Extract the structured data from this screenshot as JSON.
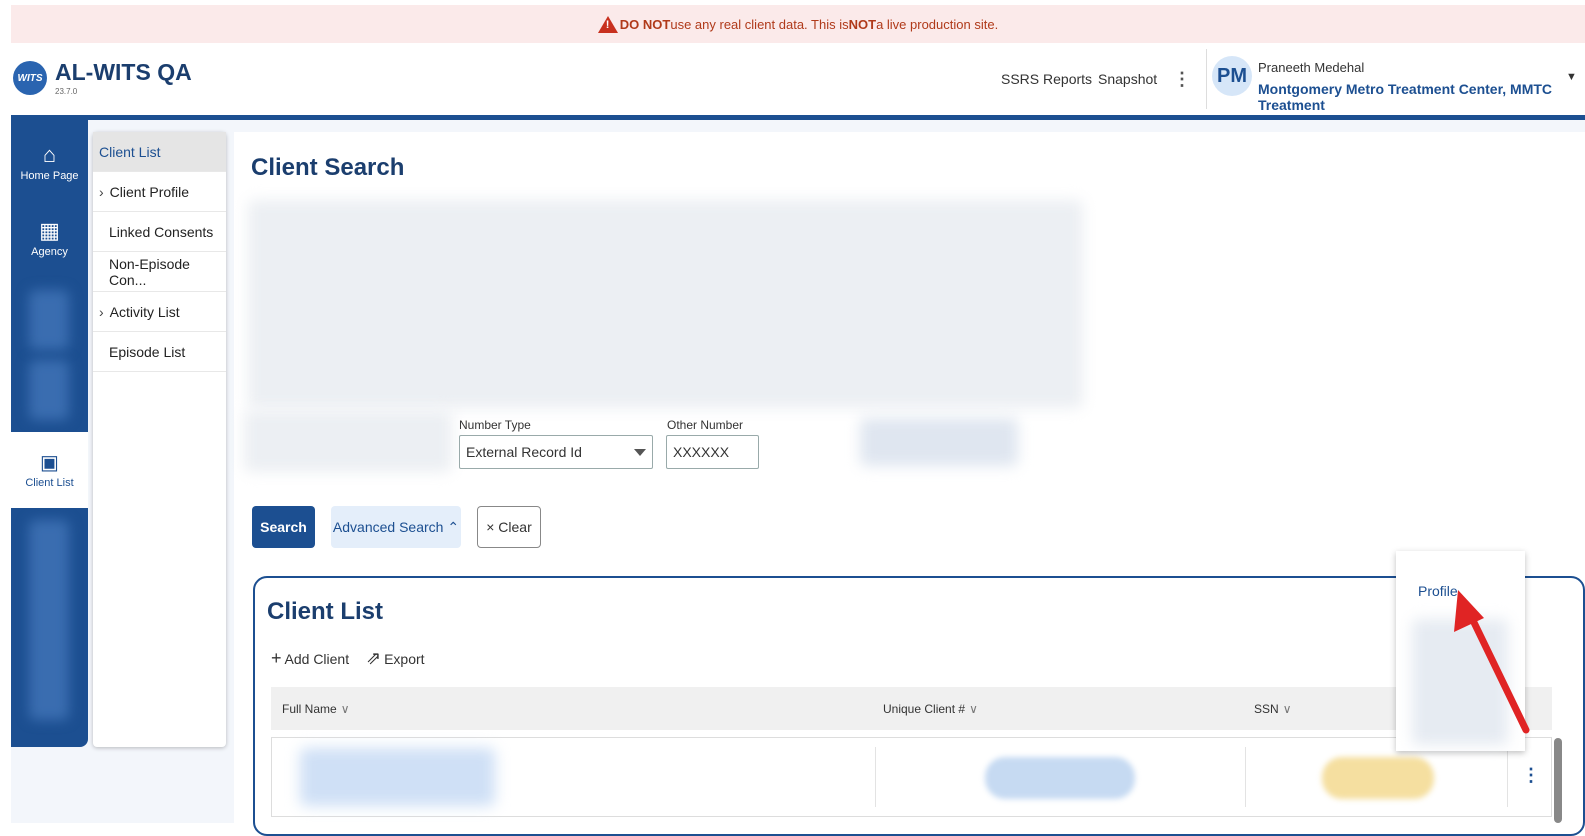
{
  "banner": {
    "part1": "DO NOT",
    "part2": " use any real client data. This is ",
    "part3": "NOT",
    "part4": " a live production site."
  },
  "header": {
    "logo_text": "WITS",
    "app_title": "AL-WITS QA",
    "version": "23.7.0",
    "links": [
      "SSRS Reports",
      "Snapshot"
    ],
    "user_initials": "PM",
    "user_name": "Praneeth Medehal",
    "user_org": "Montgomery Metro Treatment Center, MMTC Treatment"
  },
  "rail": {
    "home_label": "Home Page",
    "agency_label": "Agency",
    "clientlist_label": "Client List"
  },
  "subnav": {
    "items": [
      {
        "label": "Client List"
      },
      {
        "label": "Client Profile"
      },
      {
        "label": "Linked Consents"
      },
      {
        "label": "Non-Episode Con..."
      },
      {
        "label": "Activity List"
      },
      {
        "label": "Episode List"
      }
    ]
  },
  "search": {
    "title": "Client Search",
    "number_type_label": "Number Type",
    "number_type_value": "External Record Id",
    "other_number_label": "Other Number",
    "other_number_value": "XXXXXX",
    "search_btn": "Search",
    "advanced_btn": "Advanced Search ⌃",
    "clear_btn": "× Clear"
  },
  "client_list": {
    "title": "Client List",
    "add_client": "Add Client",
    "export": "Export",
    "columns": [
      "Full Name",
      "Unique Client #",
      "SSN"
    ]
  },
  "context_menu": {
    "profile": "Profile"
  },
  "colors": {
    "primary": "#1c4f91",
    "banner_bg": "#fbeaea",
    "arrow": "#e02424"
  },
  "icons": [
    "warning-icon",
    "home-icon",
    "agency-icon",
    "client-list-icon",
    "plus-icon",
    "export-icon",
    "chevron-down-icon",
    "kebab-icon"
  ]
}
